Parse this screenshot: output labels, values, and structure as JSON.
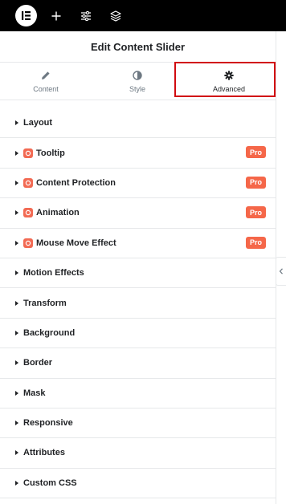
{
  "topbar": {
    "logo_icon": "elementor-logo-icon",
    "icons": [
      "plus-icon",
      "sliders-icon",
      "layers-icon"
    ]
  },
  "panel": {
    "title": "Edit Content Slider",
    "tabs": [
      {
        "label": "Content",
        "icon": "pencil-icon"
      },
      {
        "label": "Style",
        "icon": "contrast-icon"
      },
      {
        "label": "Advanced",
        "icon": "gear-icon",
        "active": true
      }
    ],
    "highlight_color": "#d10a10",
    "pro_badge_color": "#f56749",
    "sections": [
      {
        "label": "Layout"
      },
      {
        "label": "Tooltip",
        "pro": "Pro"
      },
      {
        "label": "Content Protection",
        "pro": "Pro"
      },
      {
        "label": "Animation",
        "pro": "Pro"
      },
      {
        "label": "Mouse Move Effect",
        "pro": "Pro"
      },
      {
        "label": "Motion Effects"
      },
      {
        "label": "Transform"
      },
      {
        "label": "Background"
      },
      {
        "label": "Border"
      },
      {
        "label": "Mask"
      },
      {
        "label": "Responsive"
      },
      {
        "label": "Attributes"
      },
      {
        "label": "Custom CSS"
      }
    ]
  }
}
